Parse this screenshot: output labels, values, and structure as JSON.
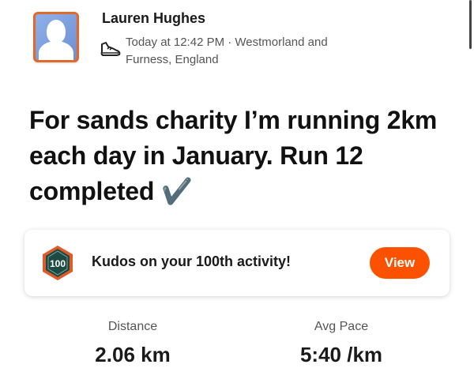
{
  "athlete": {
    "name": "Lauren Hughes",
    "avatar_icon": "profile-avatar",
    "activity_icon": "running-shoe-icon",
    "meta": "Today at 12:42 PM · Westmorland and Furness, England"
  },
  "activity": {
    "title": "For sands charity I’m running 2km each day in January. Run 12 completed",
    "title_emoji": "✔️"
  },
  "kudos": {
    "badge_number": "100",
    "message": "Kudos on your 100th activity!",
    "button_label": "View"
  },
  "stats": [
    {
      "label": "Distance",
      "value": "2.06 km"
    },
    {
      "label": "Avg Pace",
      "value": "5:40 /km"
    }
  ],
  "colors": {
    "accent": "#fc5200",
    "avatar_border": "#e06a2a",
    "badge_fill": "#1f4a44"
  }
}
